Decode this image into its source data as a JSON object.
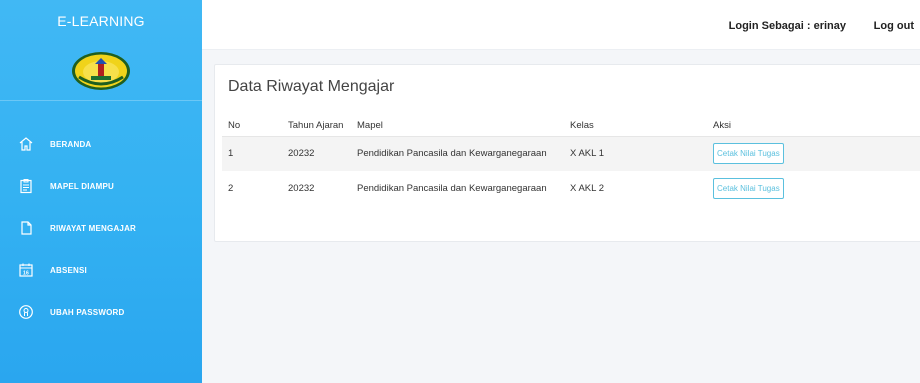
{
  "sidebar": {
    "brand": "E-LEARNING",
    "logo": {
      "text": "SMK NEGERI 1",
      "icon": "school-emblem-logo"
    },
    "items": [
      {
        "label": "BERANDA",
        "icon": "home-icon"
      },
      {
        "label": "MAPEL DIAMPU",
        "icon": "clipboard-icon"
      },
      {
        "label": "RIWAYAT MENGAJAR",
        "icon": "document-icon"
      },
      {
        "label": "ABSENSI",
        "icon": "calendar-icon"
      },
      {
        "label": "UBAH PASSWORD",
        "icon": "user-circle-icon"
      }
    ]
  },
  "topbar": {
    "login_label": "Login Sebagai : erinay",
    "logout_label": "Log out"
  },
  "main": {
    "title": "Data Riwayat Mengajar",
    "table": {
      "headers": [
        "No",
        "Tahun Ajaran",
        "Mapel",
        "Kelas",
        "Aksi"
      ],
      "rows": [
        {
          "no": "1",
          "tahun": "20232",
          "mapel": "Pendidikan Pancasila dan Kewarganegaraan",
          "kelas": "X AKL 1",
          "aksi": "Cetak Nilai Tugas"
        },
        {
          "no": "2",
          "tahun": "20232",
          "mapel": "Pendidikan Pancasila dan Kewarganegaraan",
          "kelas": "X AKL 2",
          "aksi": "Cetak Nilai Tugas"
        }
      ]
    }
  },
  "colors": {
    "sidebar": "#33b1f2",
    "action_button": "#5bc0de"
  }
}
